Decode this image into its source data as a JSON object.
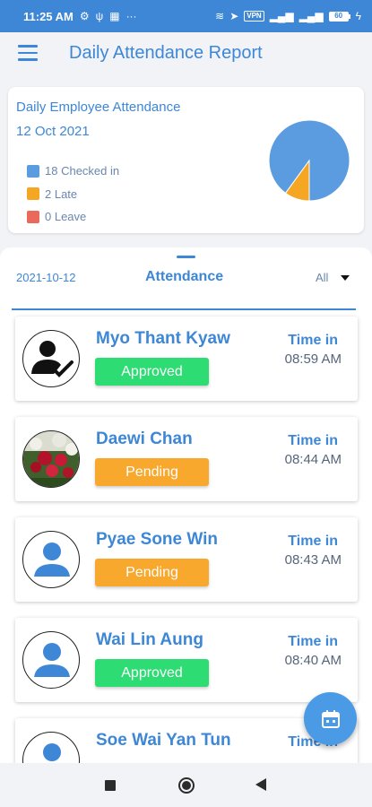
{
  "status_bar": {
    "time": "11:25 AM",
    "left_icons": [
      "gear-icon",
      "usb-icon",
      "qr-icon",
      "more-icon"
    ],
    "vpn": "VPN",
    "battery": "60"
  },
  "app_bar": {
    "title": "Daily Attendance Report"
  },
  "summary": {
    "title": "Daily Employee Attendance",
    "date": "12 Oct 2021",
    "legend": [
      {
        "label": "18 Checked in",
        "color": "#5b9be0"
      },
      {
        "label": "2 Late",
        "color": "#f5a623"
      },
      {
        "label": "0 Leave",
        "color": "#e96a5b"
      }
    ],
    "chart_data": {
      "type": "pie",
      "categories": [
        "Checked in",
        "Late",
        "Leave"
      ],
      "values": [
        18,
        2,
        0
      ],
      "colors": [
        "#5b9be0",
        "#f5a623",
        "#e96a5b"
      ]
    }
  },
  "filter": {
    "date": "2021-10-12",
    "title": "Attendance",
    "selected": "All"
  },
  "employees": [
    {
      "name": "Myo Thant Kyaw",
      "status": "Approved",
      "time_label": "Time in",
      "time": "08:59 AM",
      "avatar": "user-check-icon"
    },
    {
      "name": "Daewi Chan",
      "status": "Pending",
      "time_label": "Time in",
      "time": "08:44 AM",
      "avatar": "roses-photo"
    },
    {
      "name": "Pyae Sone Win",
      "status": "Pending",
      "time_label": "Time in",
      "time": "08:43 AM",
      "avatar": "person-icon"
    },
    {
      "name": "Wai Lin Aung",
      "status": "Approved",
      "time_label": "Time in",
      "time": "08:40 AM",
      "avatar": "person-icon"
    },
    {
      "name": "Soe Wai Yan Tun",
      "status": "",
      "time_label": "Time in",
      "time": "",
      "avatar": "person-icon"
    }
  ],
  "colors": {
    "primary": "#3d87d6",
    "approved": "#2ddc73",
    "pending": "#f8a82c"
  }
}
